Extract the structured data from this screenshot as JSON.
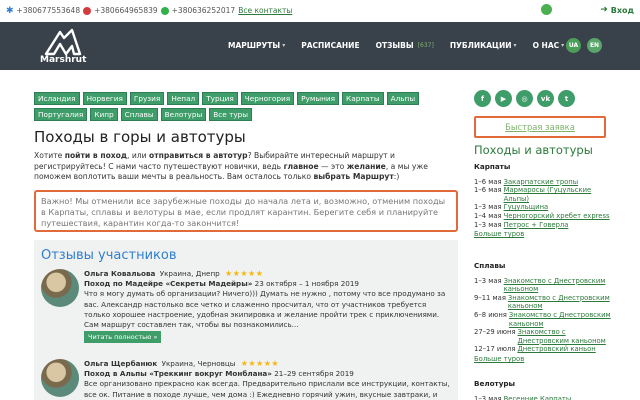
{
  "topbar": {
    "phones": [
      "+380677553648",
      "+380664965839",
      "+380636252017"
    ],
    "contacts_link": "Все контакты",
    "login": "Вход"
  },
  "header": {
    "logo_text": "Marshrut",
    "nav": [
      {
        "label": "МАРШРУТЫ",
        "has_dropdown": true
      },
      {
        "label": "РАСПИСАНИЕ",
        "has_dropdown": false
      },
      {
        "label": "ОТЗЫВЫ",
        "badge": "[637]",
        "has_dropdown": false
      },
      {
        "label": "ПУБЛИКАЦИИ",
        "has_dropdown": true
      },
      {
        "label": "О НАС",
        "has_dropdown": true
      }
    ],
    "languages": [
      "UA",
      "EN"
    ]
  },
  "tags": [
    "Исландия",
    "Норвегия",
    "Грузия",
    "Непал",
    "Турция",
    "Черногория",
    "Румыния",
    "Карпаты",
    "Альпы",
    "Португалия",
    "Кипр",
    "Сплавы",
    "Велотуры",
    "Все туры"
  ],
  "social_icons": [
    "facebook-icon",
    "youtube-icon",
    "instagram-icon",
    "vk-icon",
    "twitter-icon"
  ],
  "main": {
    "title": "Походы в горы и автотуры",
    "intro": {
      "p1": "Хотите ",
      "b1": "пойти в поход",
      "p2": ", или ",
      "b2": "отправиться в автотур",
      "p3": "? Выбирайте интересный маршрут и регистрируйтесь! С нами часто путешествуют новички, ведь ",
      "b3": "главное",
      "p4": " — это ",
      "b4": "желание",
      "p5": ", а мы уже поможем воплотить ваши мечты в реальность. Вам осталось только ",
      "b5": "выбрать Маршрут",
      "p6": ":)"
    },
    "alert": "Важно! Мы отменили все зарубежные походы до начала лета и, возможно, отменим походы в Карпаты, сплавы и велотуры в мае, если продлят карантин. Берегите себя и планируйте путешествия, карантин когда-то закончится!"
  },
  "reviews": {
    "title": "Отзывы участников",
    "items": [
      {
        "author": "Ольга Ковальова",
        "location": "Украина, Днепр",
        "stars": "★★★★★",
        "trip_prefix": "Поход по Мадейре «Секреты Мадейры»",
        "trip_dates": "23 октября – 1 ноября 2019",
        "text": "Что я могу думать об организации? Ничего))) Думать не нужно , потому что все продумано за вас. Александр настолько все четко и слаженно просчитал, что от участников требуется только хорошее настроение, удобная экипировка и желание пройти трек с приключениями. Сам маршрут составлен так, чтобы вы познакомились...",
        "more": "Читать полностью »"
      },
      {
        "author": "Ольга Щербанюк",
        "location": "Украина, Черновцы",
        "stars": "★★★★★",
        "trip_prefix": "Поход в Альпы «Треккинг вокруг Монблана»",
        "trip_dates": "21–29 сентября 2019",
        "text": "Все организовано прекрасно как всегда. Предварительно прислали все инструкции, контакты, все ок. Питание в походе лучше, чем дома :) Ежедневно горячий ужин, вкусные завтраки, и",
        "more": ""
      }
    ]
  },
  "sidebar": {
    "quick_request": "Быстрая заявка",
    "title": "Походы и автотуры",
    "sections": [
      {
        "head": "Карпаты",
        "rows": [
          {
            "date": "1–6 мая",
            "name": "Закарпатские тропы"
          },
          {
            "date": "1–6 мая",
            "name": "Мармаросы (Гуцульские Альпы)"
          },
          {
            "date": "1–3 мая",
            "name": "Гуцульщина"
          },
          {
            "date": "1–4 мая",
            "name": "Черногорский хребет express"
          },
          {
            "date": "1–3 мая",
            "name": "Петрос + Говерла"
          }
        ],
        "more": "Больше туров"
      },
      {
        "head": "Сплавы",
        "rows": [
          {
            "date": "1–3 мая",
            "name": "Знакомство с Днестровским каньоном"
          },
          {
            "date": "9–11 мая",
            "name": "Знакомство с Днестровским каньоном"
          },
          {
            "date": "6–8 июня",
            "name": "Знакомство с Днестровским каньоном"
          },
          {
            "date": "27–29 июня",
            "name": "Знакомство с Днестровским каньоном"
          },
          {
            "date": "12–17 июля",
            "name": "Днестровский каньон"
          }
        ],
        "more": "Больше туров"
      },
      {
        "head": "Велотуры",
        "rows": [
          {
            "date": "1–3 мая",
            "name": "Весенние Карпаты"
          }
        ],
        "more": ""
      }
    ]
  },
  "colors": {
    "header_bg": "#39424b",
    "accent_green": "#3f9d69",
    "link_green": "#2b7a3b",
    "alert_border": "#e06a3a",
    "review_title": "#2f7fd1"
  }
}
